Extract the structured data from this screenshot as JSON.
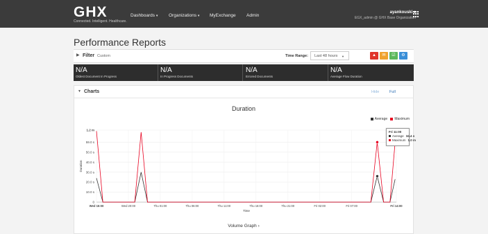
{
  "header": {
    "logo": "GHX",
    "tagline": "Connected. Intelligent. Healthcare.",
    "nav": [
      {
        "label": "Dashboards",
        "dropdown": true
      },
      {
        "label": "Organizations",
        "dropdown": true
      },
      {
        "label": "MyExchange",
        "dropdown": false
      },
      {
        "label": "Admin",
        "dropdown": false
      }
    ],
    "user_name": "ayankouski",
    "user_org": "EGX_admin @ GHX Base Organization"
  },
  "page_title": "Performance Reports",
  "filter": {
    "label": "Filter",
    "value": "Custom",
    "time_range_label": "Time Range:",
    "time_range_value": "Last 48 hours",
    "buttons": [
      {
        "name": "alert",
        "color": "#e0342a",
        "glyph": "▲"
      },
      {
        "name": "envelope",
        "color": "#f0a22e",
        "glyph": "✉"
      },
      {
        "name": "checklist",
        "color": "#5cb85c",
        "glyph": "☑"
      },
      {
        "name": "gear",
        "color": "#3a8fd8",
        "glyph": "⚙"
      }
    ]
  },
  "stats": [
    {
      "value": "N/A",
      "label": "Oldest Document In Progress"
    },
    {
      "value": "N/A",
      "label": "In Progress Documents"
    },
    {
      "value": "N/A",
      "label": "Errored Documents"
    },
    {
      "value": "N/A",
      "label": "Average Flow Duration"
    }
  ],
  "charts": {
    "label": "Charts",
    "hide": "Hide",
    "full": "Full",
    "volume_graph": "Volume Graph ›"
  },
  "chart_data": {
    "type": "line",
    "title": "Duration",
    "xlabel": "Time",
    "ylabel": "Duration",
    "ylim": [
      0,
      72
    ],
    "y_unit": "seconds",
    "yticks": [
      {
        "v": 0,
        "label": "0"
      },
      {
        "v": 10,
        "label": "10.0 s"
      },
      {
        "v": 20,
        "label": "20.0 s"
      },
      {
        "v": 30,
        "label": "30.0 s"
      },
      {
        "v": 40,
        "label": "40.0 s"
      },
      {
        "v": 50,
        "label": "50.0 s"
      },
      {
        "v": 60,
        "label": "59.0 s"
      },
      {
        "v": 72,
        "label": "1.2 m"
      }
    ],
    "xticks": [
      {
        "h": 0,
        "label": "Wed 15:00",
        "bold": true
      },
      {
        "h": 5,
        "label": "Wed 20:00",
        "bold": false
      },
      {
        "h": 10,
        "label": "Thu 01:00",
        "bold": false
      },
      {
        "h": 15,
        "label": "Thu 06:00",
        "bold": false
      },
      {
        "h": 20,
        "label": "Thu 11:00",
        "bold": false
      },
      {
        "h": 25,
        "label": "Thu 16:00",
        "bold": false
      },
      {
        "h": 30,
        "label": "Thu 21:00",
        "bold": false
      },
      {
        "h": 35,
        "label": "Fri 02:00",
        "bold": false
      },
      {
        "h": 40,
        "label": "Fri 07:00",
        "bold": false
      },
      {
        "h": 47,
        "label": "Fri 14:00",
        "bold": true
      }
    ],
    "x_range": [
      0,
      47
    ],
    "series": [
      {
        "name": "Average",
        "color": "#333333",
        "points": [
          [
            0,
            24
          ],
          [
            1,
            0
          ],
          [
            6,
            0
          ],
          [
            7,
            30
          ],
          [
            8,
            0
          ],
          [
            43,
            0
          ],
          [
            44,
            26
          ],
          [
            45,
            0
          ],
          [
            46,
            0
          ],
          [
            46.8,
            23
          ]
        ]
      },
      {
        "name": "Maximum",
        "color": "#e8001f",
        "points": [
          [
            0,
            71
          ],
          [
            1,
            0
          ],
          [
            6,
            0
          ],
          [
            7,
            70
          ],
          [
            8,
            0
          ],
          [
            43,
            0
          ],
          [
            44,
            60
          ],
          [
            45,
            0
          ],
          [
            46,
            0
          ],
          [
            46.8,
            60
          ]
        ]
      }
    ],
    "markers": [
      {
        "series": "Average",
        "x": 44,
        "y": 26
      },
      {
        "series": "Maximum",
        "x": 44,
        "y": 60
      }
    ],
    "tooltip": {
      "title": "Fri 11:00",
      "rows": [
        {
          "name": "Average",
          "value": "34.4 s",
          "color": "#333333"
        },
        {
          "name": "Maximum",
          "value": "1.0 m",
          "color": "#e8001f"
        }
      ]
    }
  }
}
